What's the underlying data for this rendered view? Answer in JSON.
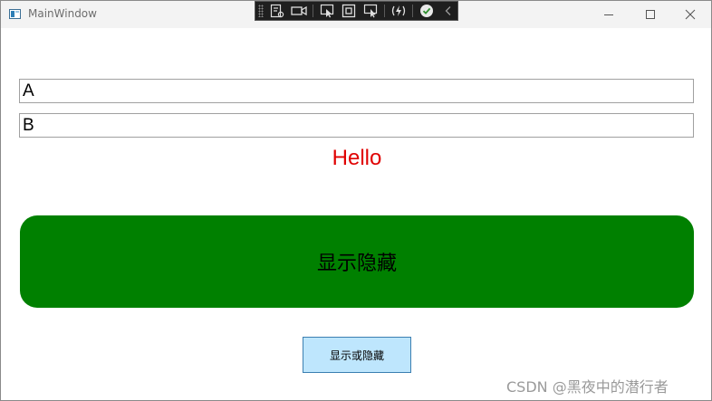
{
  "window": {
    "title": "MainWindow",
    "icon": "app-window-icon",
    "controls": [
      "minimize-icon",
      "maximize-icon",
      "close-icon"
    ]
  },
  "debug_toolbar": {
    "icons": [
      "live-visual-tree-icon",
      "video-camera-icon",
      "select-element-icon",
      "layout-adorner-icon",
      "track-focus-icon",
      "hot-reload-icon",
      "checkmark-icon",
      "collapse-chevron-icon"
    ]
  },
  "main": {
    "field_a_value": "A",
    "field_b_value": "B",
    "hello_text": "Hello",
    "toggle_big_label": "显示隐藏",
    "toggle_small_label": "显示或隐藏"
  },
  "watermark": "CSDN @黑夜中的潜行者",
  "colors": {
    "hello": "#e00000",
    "big_button_bg": "#008000",
    "small_button_bg": "#bee6fd",
    "small_button_border": "#3c7fb1",
    "titlebar_bg": "#f3f3f3",
    "toolbar_bg": "#1f1f1f"
  }
}
